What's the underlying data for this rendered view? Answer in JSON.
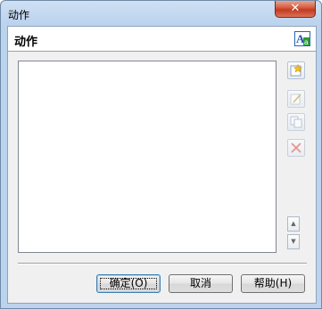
{
  "window": {
    "title": "动作",
    "close_symbol": "✕"
  },
  "header": {
    "title": "动作",
    "icon": "font-aa-icon"
  },
  "list": {
    "items": []
  },
  "side_buttons": [
    {
      "name": "new-action-button",
      "icon": "star-new-icon",
      "enabled": true
    },
    {
      "name": "edit-action-button",
      "icon": "edit-icon",
      "enabled": false
    },
    {
      "name": "copy-action-button",
      "icon": "copy-icon",
      "enabled": false
    },
    {
      "name": "delete-action-button",
      "icon": "delete-x-icon",
      "enabled": false
    }
  ],
  "order_buttons": {
    "up_symbol": "▲",
    "down_symbol": "▼"
  },
  "buttons": {
    "ok": "确定(O)",
    "cancel": "取消",
    "help": "帮助(H)"
  }
}
